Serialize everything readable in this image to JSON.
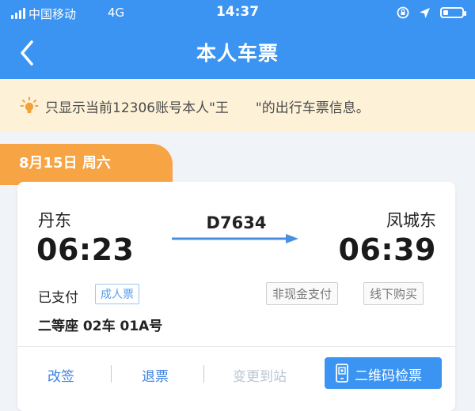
{
  "status_bar": {
    "carrier": "中国移动",
    "network": "4G",
    "time": "14:37"
  },
  "header": {
    "title": "本人车票"
  },
  "notice": {
    "text": "只显示当前12306账号本人\"王　　\"的出行车票信息。"
  },
  "ticket": {
    "date": "8月15日 周六",
    "from_station": "丹东",
    "depart_time": "06:23",
    "train_no": "D7634",
    "to_station": "凤城东",
    "arrive_time": "06:39",
    "pay_status": "已支付",
    "passenger_type": "成人票",
    "tags": [
      "非现金支付",
      "线下购买"
    ],
    "seat": "二等座 02车 01A号"
  },
  "actions": {
    "change": "改签",
    "refund": "退票",
    "change_station": "变更到站",
    "qr_check": "二维码检票"
  },
  "colors": {
    "header_blue": "#3b94f1",
    "notice_bg": "#fdf2d8",
    "date_tab_orange": "#f7a445",
    "link_blue": "#3b82e0"
  }
}
